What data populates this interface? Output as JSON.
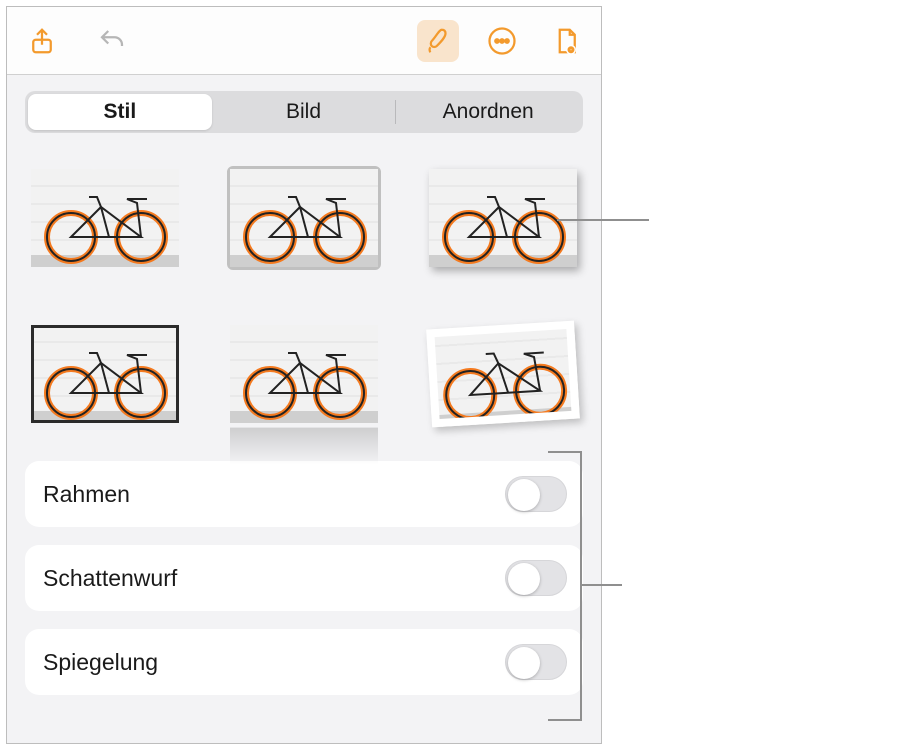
{
  "toolbar": {
    "share_icon": "share-icon",
    "undo_icon": "undo-icon",
    "format_icon": "brush-icon",
    "more_icon": "more-icon",
    "doc_icon": "document-view-icon"
  },
  "tabs": {
    "items": [
      {
        "label": "Stil",
        "active": true
      },
      {
        "label": "Bild",
        "active": false
      },
      {
        "label": "Anordnen",
        "active": false
      }
    ]
  },
  "style_presets": [
    {
      "name": "preset-none",
      "selected": false
    },
    {
      "name": "preset-outline",
      "selected": true
    },
    {
      "name": "preset-shadow",
      "selected": false
    },
    {
      "name": "preset-border-dark",
      "selected": false
    },
    {
      "name": "preset-reflection",
      "selected": false
    },
    {
      "name": "preset-photo-frame",
      "selected": false
    }
  ],
  "options": [
    {
      "key": "border",
      "label": "Rahmen",
      "value": false
    },
    {
      "key": "shadow",
      "label": "Schattenwurf",
      "value": false
    },
    {
      "key": "reflection",
      "label": "Spiegelung",
      "value": false
    }
  ]
}
